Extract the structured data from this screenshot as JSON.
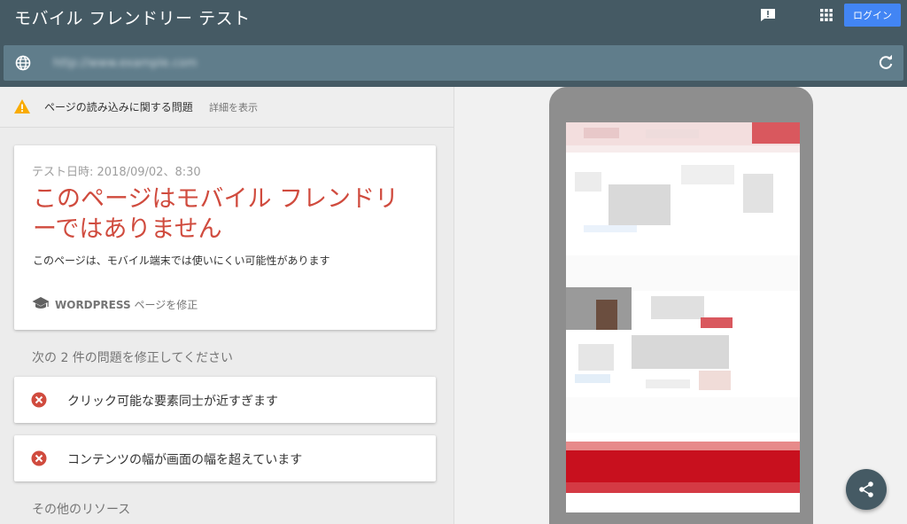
{
  "header": {
    "title": "モバイル フレンドリー テスト",
    "feedback_icon": "feedback-icon",
    "apps_icon": "apps-icon",
    "login_label": "ログイン"
  },
  "url_bar": {
    "globe_icon": "globe-icon",
    "url": "http://www.example.com",
    "reload_icon": "reload-icon"
  },
  "issue_banner": {
    "icon": "warning-icon",
    "text": "ページの読み込みに関する問題",
    "details_link": "詳細を表示"
  },
  "result": {
    "test_date": "テスト日時: 2018/09/02、8:30",
    "title": "このページはモバイル フレンドリーではありません",
    "description": "このページは、モバイル端末では使いにくい可能性があります",
    "fix_platform": "WORDPRESS",
    "fix_suffix": " ページを修正"
  },
  "problems": {
    "heading": "次の 2 件の問題を修正してください",
    "items": [
      {
        "icon": "error-icon",
        "label": "クリック可能な要素同士が近すぎます"
      },
      {
        "icon": "error-icon",
        "label": "コンテンツの幅が画面の幅を超えています"
      }
    ]
  },
  "resources": {
    "heading": "その他のリソース"
  },
  "colors": {
    "header_bg": "#455a64",
    "url_bar_bg": "#607d8b",
    "login_button": "#4285f4",
    "error_red": "#d04b3e",
    "warning_yellow": "#f9ab00"
  }
}
